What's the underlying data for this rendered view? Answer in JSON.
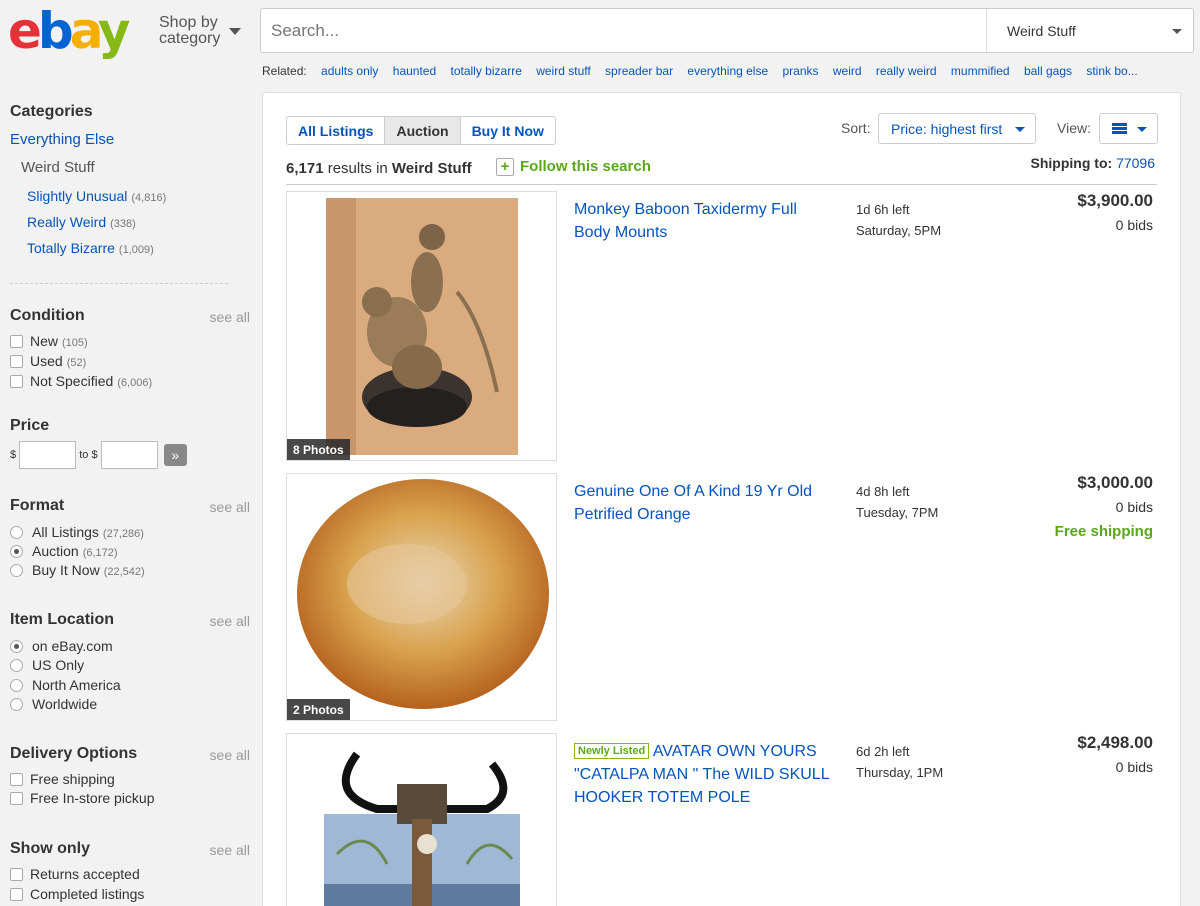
{
  "header": {
    "logo": [
      "e",
      "b",
      "a",
      "y"
    ],
    "shop_by_line1": "Shop by",
    "shop_by_line2": "category",
    "search_placeholder": "Search...",
    "search_category": "Weird Stuff",
    "related_label": "Related:",
    "related": [
      "adults only",
      "haunted",
      "totally bizarre",
      "weird stuff",
      "spreader bar",
      "everything else",
      "pranks",
      "weird",
      "really weird",
      "mummified",
      "ball gags",
      "stink bo..."
    ]
  },
  "sidebar": {
    "categories_title": "Categories",
    "category_top": "Everything Else",
    "category_current": "Weird Stuff",
    "subcategories": [
      {
        "label": "Slightly Unusual",
        "count": "(4,816)"
      },
      {
        "label": "Really Weird",
        "count": "(338)"
      },
      {
        "label": "Totally Bizarre",
        "count": "(1,009)"
      }
    ],
    "see_all": "see all",
    "condition": {
      "title": "Condition",
      "options": [
        {
          "label": "New",
          "count": "(105)"
        },
        {
          "label": "Used",
          "count": "(52)"
        },
        {
          "label": "Not Specified",
          "count": "(6,006)"
        }
      ]
    },
    "price": {
      "title": "Price",
      "from_label": "$",
      "to_label": "to $",
      "go": "»"
    },
    "format": {
      "title": "Format",
      "options": [
        {
          "label": "All Listings",
          "count": "(27,286)",
          "selected": false
        },
        {
          "label": "Auction",
          "count": "(6,172)",
          "selected": true
        },
        {
          "label": "Buy It Now",
          "count": "(22,542)",
          "selected": false
        }
      ]
    },
    "location": {
      "title": "Item Location",
      "options": [
        {
          "label": "on eBay.com",
          "selected": true
        },
        {
          "label": "US Only",
          "selected": false
        },
        {
          "label": "North America",
          "selected": false
        },
        {
          "label": "Worldwide",
          "selected": false
        }
      ]
    },
    "delivery": {
      "title": "Delivery Options",
      "options": [
        "Free shipping",
        "Free In-store pickup"
      ]
    },
    "show_only": {
      "title": "Show only",
      "options": [
        "Returns accepted",
        "Completed listings"
      ]
    }
  },
  "main": {
    "tabs": [
      "All Listings",
      "Auction",
      "Buy It Now"
    ],
    "active_tab": "Auction",
    "sort_label": "Sort:",
    "sort_value": "Price: highest first",
    "view_label": "View:",
    "results_count": "6,171",
    "results_in": "results in",
    "results_category": "Weird Stuff",
    "follow_label": "Follow this search",
    "shipping_label": "Shipping to:",
    "shipping_zip": "77096",
    "items": [
      {
        "photos": "8 Photos",
        "title": "Monkey Baboon Taxidermy Full Body Mounts",
        "newly_listed": "",
        "time_left": "1d 6h left",
        "end_time": "Saturday, 5PM",
        "price": "$3,900.00",
        "bids": "0 bids",
        "shipping": ""
      },
      {
        "photos": "2 Photos",
        "title": "Genuine One Of A Kind 19 Yr Old Petrified Orange",
        "newly_listed": "",
        "time_left": "4d 8h left",
        "end_time": "Tuesday, 7PM",
        "price": "$3,000.00",
        "bids": "0 bids",
        "shipping": "Free shipping"
      },
      {
        "photos": "",
        "title": "AVATAR OWN YOURS \"CATALPA MAN \" The WILD SKULL HOOKER TOTEM POLE",
        "newly_listed": "Newly Listed",
        "time_left": "6d 2h left",
        "end_time": "Thursday, 1PM",
        "price": "$2,498.00",
        "bids": "0 bids",
        "shipping": ""
      }
    ]
  }
}
